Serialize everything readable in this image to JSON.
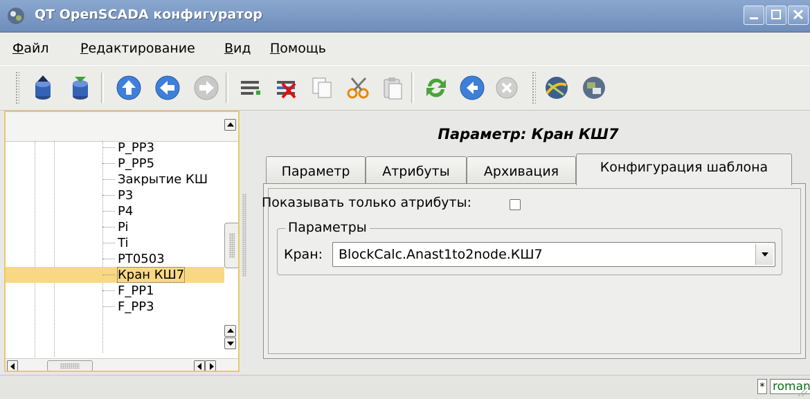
{
  "window": {
    "title": "QT OpenSCADA конфигуратор"
  },
  "menu": [
    {
      "label": "Файл"
    },
    {
      "label": "Редактирование"
    },
    {
      "label": "Вид"
    },
    {
      "label": "Помощь"
    }
  ],
  "toolbar": {
    "icons": [
      "db-load-icon",
      "db-save-icon",
      "up-icon",
      "back-icon",
      "forward-icon",
      "add-item-icon",
      "delete-item-icon",
      "copy-icon",
      "cut-icon",
      "paste-icon",
      "refresh-icon",
      "start-icon",
      "stop-icon",
      "remote-host-icon",
      "remote-host-2-icon"
    ]
  },
  "tree": {
    "items": [
      "P_PP3",
      "P_PP5",
      "Закрытие КШ",
      "P3",
      "P4",
      "Pi",
      "Ti",
      "PT0503",
      "Кран КШ7",
      "F_PP1",
      "F_PP3"
    ],
    "selected": "Кран КШ7"
  },
  "panel": {
    "title": "Параметр: Кран КШ7",
    "tabs": [
      "Параметр",
      "Атрибуты",
      "Архивация",
      "Конфигурация шаблона"
    ],
    "active_tab": "Конфигурация шаблона",
    "show_attr_label": "Показывать только атрибуты:",
    "group_title": "Параметры",
    "kran_label": "Кран:",
    "kran_value": "BlockCalc.Anast1to2node.КШ7"
  },
  "status": {
    "modified": "*",
    "user": "roman"
  },
  "colors": {
    "title_bar": "#7b98c4",
    "selection": "#f8d882",
    "focus_border": "#e9c86a",
    "user_text": "#0a6e14"
  }
}
